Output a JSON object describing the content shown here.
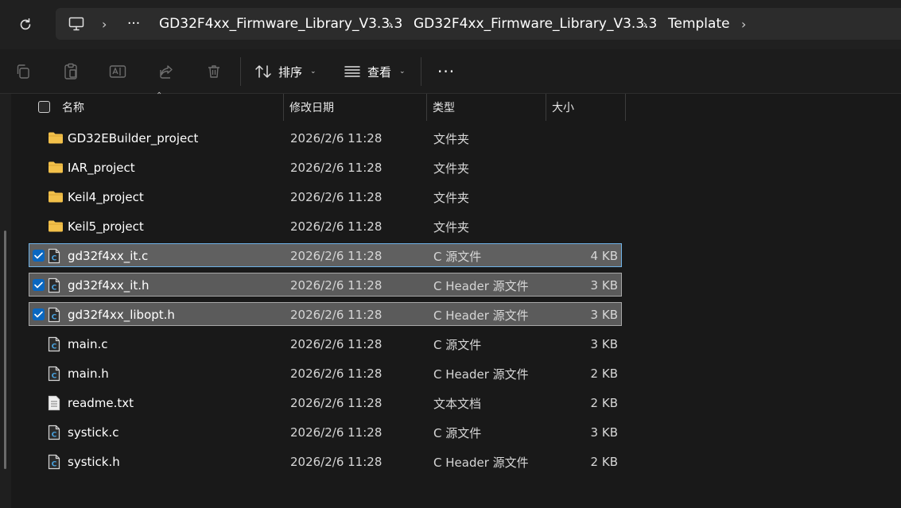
{
  "address_bar": {
    "ellipsis": "···",
    "crumbs": [
      "GD32F4xx_Firmware_Library_V3.3.3",
      "GD32F4xx_Firmware_Library_V3.3.3",
      "Template"
    ]
  },
  "toolbar": {
    "sort_label": "排序",
    "view_label": "查看",
    "more_label": "···"
  },
  "columns": {
    "name": "名称",
    "date": "修改日期",
    "type": "类型",
    "size": "大小"
  },
  "files": [
    {
      "name": "GD32EBuilder_project",
      "date": "2026/2/6 11:28",
      "type": "文件夹",
      "size": "",
      "kind": "folder",
      "selected": false
    },
    {
      "name": "IAR_project",
      "date": "2026/2/6 11:28",
      "type": "文件夹",
      "size": "",
      "kind": "folder",
      "selected": false
    },
    {
      "name": "Keil4_project",
      "date": "2026/2/6 11:28",
      "type": "文件夹",
      "size": "",
      "kind": "folder",
      "selected": false
    },
    {
      "name": "Keil5_project",
      "date": "2026/2/6 11:28",
      "type": "文件夹",
      "size": "",
      "kind": "folder",
      "selected": false
    },
    {
      "name": "gd32f4xx_it.c",
      "date": "2026/2/6 11:28",
      "type": "C 源文件",
      "size": "4 KB",
      "kind": "c-file",
      "selected": true
    },
    {
      "name": "gd32f4xx_it.h",
      "date": "2026/2/6 11:28",
      "type": "C Header 源文件",
      "size": "3 KB",
      "kind": "c-file",
      "selected": true
    },
    {
      "name": "gd32f4xx_libopt.h",
      "date": "2026/2/6 11:28",
      "type": "C Header 源文件",
      "size": "3 KB",
      "kind": "c-file",
      "selected": true
    },
    {
      "name": "main.c",
      "date": "2026/2/6 11:28",
      "type": "C 源文件",
      "size": "3 KB",
      "kind": "c-file",
      "selected": false
    },
    {
      "name": "main.h",
      "date": "2026/2/6 11:28",
      "type": "C Header 源文件",
      "size": "2 KB",
      "kind": "c-file",
      "selected": false
    },
    {
      "name": "readme.txt",
      "date": "2026/2/6 11:28",
      "type": "文本文档",
      "size": "2 KB",
      "kind": "text-file",
      "selected": false
    },
    {
      "name": "systick.c",
      "date": "2026/2/6 11:28",
      "type": "C 源文件",
      "size": "3 KB",
      "kind": "c-file",
      "selected": false
    },
    {
      "name": "systick.h",
      "date": "2026/2/6 11:28",
      "type": "C Header 源文件",
      "size": "2 KB",
      "kind": "c-file",
      "selected": false
    }
  ],
  "colors": {
    "background": "#191919",
    "selection": "#5b5b5b",
    "checkbox_accent": "#0a67c0",
    "folder": "#f2c04a"
  }
}
